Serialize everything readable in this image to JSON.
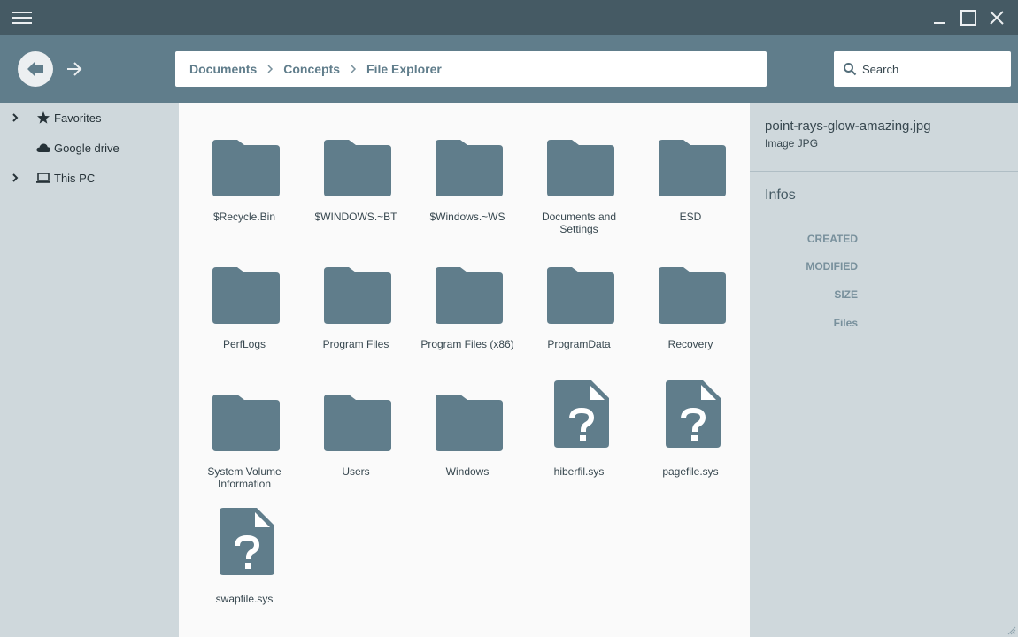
{
  "window": {
    "menu_icon": "hamburger-icon",
    "controls": [
      "minimize-icon",
      "maximize-icon",
      "close-icon"
    ]
  },
  "nav": {
    "back_icon": "arrow-back-icon",
    "forward_icon": "arrow-forward-icon"
  },
  "breadcrumb": [
    "Documents",
    "Concepts",
    "File Explorer"
  ],
  "search": {
    "placeholder": "Search",
    "icon": "search-icon"
  },
  "sidebar": {
    "items": [
      {
        "label": "Favorites",
        "icon": "star-icon",
        "expandable": true
      },
      {
        "label": "Google drive",
        "icon": "cloud-icon",
        "expandable": false
      },
      {
        "label": "This PC",
        "icon": "laptop-icon",
        "expandable": true
      }
    ]
  },
  "files": [
    {
      "name": "$Recycle.Bin",
      "kind": "folder"
    },
    {
      "name": "$WINDOWS.~BT",
      "kind": "folder"
    },
    {
      "name": "$Windows.~WS",
      "kind": "folder"
    },
    {
      "name": "Documents and Settings",
      "kind": "folder"
    },
    {
      "name": "ESD",
      "kind": "folder"
    },
    {
      "name": "PerfLogs",
      "kind": "folder"
    },
    {
      "name": "Program Files",
      "kind": "folder"
    },
    {
      "name": "Program Files (x86)",
      "kind": "folder"
    },
    {
      "name": "ProgramData",
      "kind": "folder"
    },
    {
      "name": "Recovery",
      "kind": "folder"
    },
    {
      "name": "System Volume Information",
      "kind": "folder"
    },
    {
      "name": "Users",
      "kind": "folder"
    },
    {
      "name": "Windows",
      "kind": "folder"
    },
    {
      "name": "hiberfil.sys",
      "kind": "unknown-file"
    },
    {
      "name": "pagefile.sys",
      "kind": "unknown-file"
    },
    {
      "name": "swapfile.sys",
      "kind": "unknown-file"
    }
  ],
  "details": {
    "file_name": "point-rays-glow-amazing.jpg",
    "file_type": "Image JPG",
    "section_title": "Infos",
    "fields": [
      "CREATED",
      "MODIFIED",
      "SIZE",
      "Files"
    ]
  },
  "colors": {
    "titlebar": "#455a64",
    "toolbar": "#607d8b",
    "icon": "#607d8b",
    "panel": "#cfd8dc",
    "content": "#fafafa"
  }
}
